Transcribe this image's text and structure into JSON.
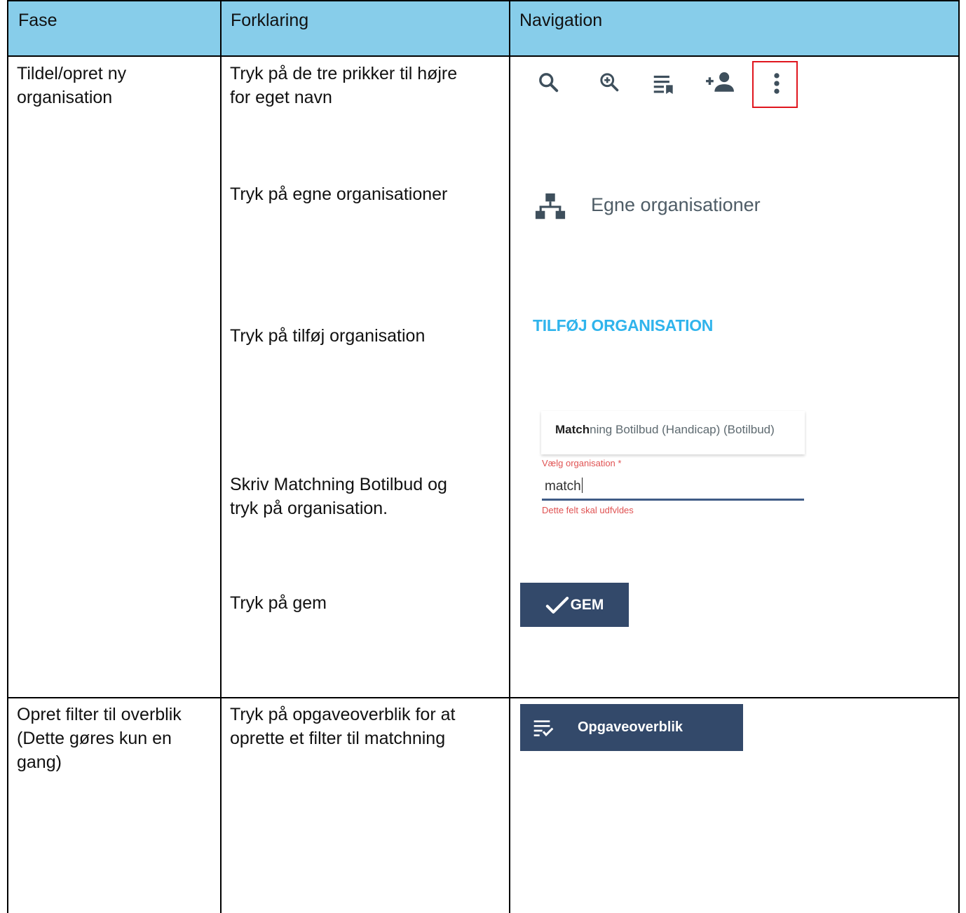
{
  "table": {
    "headers": [
      "Fase",
      "Forklaring",
      "Navigation"
    ],
    "colors": {
      "header_bg": "#87cdea",
      "border": "#000000"
    },
    "rows": [
      {
        "fase": [
          "Tildel/opret ny",
          "organisation"
        ],
        "steps": [
          {
            "text": [
              "Tryk på de tre prikker til højre",
              "for eget navn"
            ]
          },
          {
            "text": [
              "Tryk på egne organisationer"
            ]
          },
          {
            "text": [
              "Tryk på tilføj organisation"
            ]
          },
          {
            "text": [
              "Skriv Matchning Botilbud og",
              "tryk på organisation."
            ]
          },
          {
            "text": [
              "Tryk på gem"
            ]
          }
        ]
      },
      {
        "fase": [
          "Opret filter til overblik",
          "(Dette gøres kun en",
          "gang)"
        ],
        "steps": [
          {
            "text": [
              "Tryk på opgaveoverblik for at",
              "oprette et filter til matchning"
            ]
          }
        ]
      }
    ]
  },
  "navigation": {
    "toolbar_icons": [
      "search-icon",
      "zoom-in-icon",
      "list-bookmark-icon",
      "add-person-icon",
      "more-vertical-icon"
    ],
    "highlight_color": "#e0161e",
    "egne_organisationer": {
      "icon": "sitemap-icon",
      "label": "Egne organisationer"
    },
    "tilfoj_organisation": {
      "label": "TILFØJ ORGANISATION",
      "color": "#30b4ec"
    },
    "org_select": {
      "option_bold": "Match",
      "option_rest": "ning Botilbud (Handicap) (Botilbud)",
      "field_label": "Vælg organisation *",
      "field_value": "match",
      "error_text": "Dette felt skal udfyldes"
    },
    "gem_button": {
      "icon": "check-icon",
      "label": "GEM",
      "bg": "#33496a"
    },
    "overview_button": {
      "icon": "task-list-check-icon",
      "label": "Opgaveoverblik",
      "bg": "#33496a"
    }
  }
}
